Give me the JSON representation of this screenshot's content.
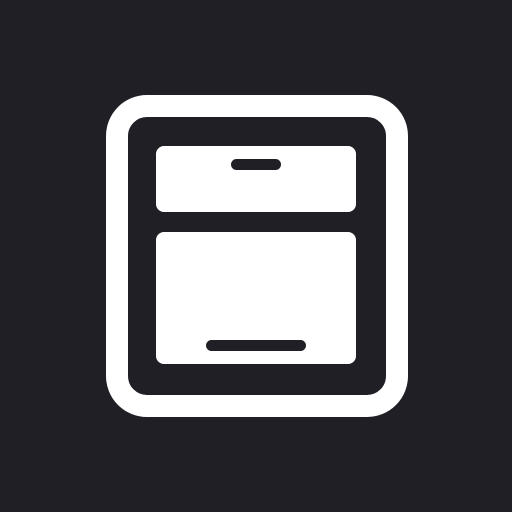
{
  "icon": {
    "name": "cabinet-icon",
    "colors": {
      "background": "#1f1f25",
      "foreground": "#ffffff"
    }
  }
}
